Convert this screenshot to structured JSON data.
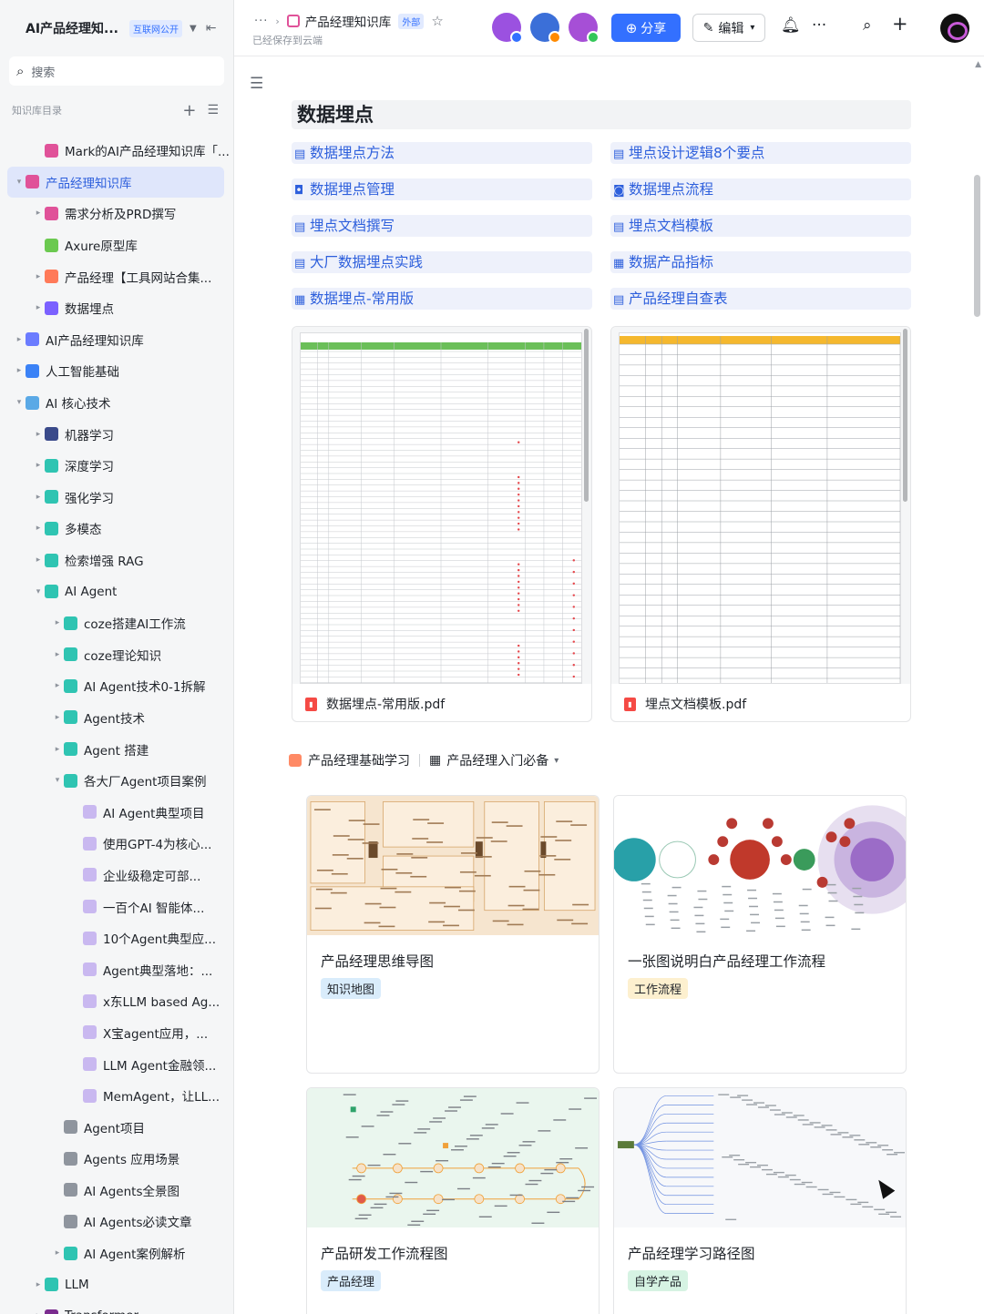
{
  "sidebar": {
    "title": "AI产品经理知...",
    "title_tag": "互联网公开",
    "search_placeholder": "搜索",
    "section_label": "知识库目录",
    "items": [
      {
        "label": "Mark的AI产品经理知识库「...",
        "level": 1,
        "arrow": "",
        "icon": "#e05299",
        "active": false
      },
      {
        "label": "产品经理知识库",
        "level": 0,
        "arrow": "▾",
        "icon": "#e05299",
        "active": true
      },
      {
        "label": "需求分析及PRD撰写",
        "level": 1,
        "arrow": "▸",
        "icon": "#e05299",
        "active": false
      },
      {
        "label": "Axure原型库",
        "level": 1,
        "arrow": "",
        "icon": "#6bc950",
        "active": false
      },
      {
        "label": "产品经理【工具网站合集...",
        "level": 1,
        "arrow": "▸",
        "icon": "#ff7a59",
        "active": false
      },
      {
        "label": "数据埋点",
        "level": 1,
        "arrow": "▸",
        "icon": "#7b61ff",
        "active": false
      },
      {
        "label": "AI产品经理知识库",
        "level": 0,
        "arrow": "▸",
        "icon": "#6b7cff",
        "active": false
      },
      {
        "label": "人工智能基础",
        "level": 0,
        "arrow": "▸",
        "icon": "#3b82f6",
        "active": false
      },
      {
        "label": "AI 核心技术",
        "level": 0,
        "arrow": "▾",
        "icon": "#5aa9e6",
        "active": false
      },
      {
        "label": "机器学习",
        "level": 1,
        "arrow": "▸",
        "icon": "#3a4a8a",
        "active": false
      },
      {
        "label": "深度学习",
        "level": 1,
        "arrow": "▸",
        "icon": "#2fc4b2",
        "active": false
      },
      {
        "label": "强化学习",
        "level": 1,
        "arrow": "▸",
        "icon": "#2fc4b2",
        "active": false
      },
      {
        "label": "多模态",
        "level": 1,
        "arrow": "▸",
        "icon": "#2fc4b2",
        "active": false
      },
      {
        "label": "检索增强 RAG",
        "level": 1,
        "arrow": "▸",
        "icon": "#2fc4b2",
        "active": false
      },
      {
        "label": "AI Agent",
        "level": 1,
        "arrow": "▾",
        "icon": "#2fc4b2",
        "active": false
      },
      {
        "label": "coze搭建AI工作流",
        "level": 2,
        "arrow": "▸",
        "icon": "#2fc4b2",
        "active": false
      },
      {
        "label": "coze理论知识",
        "level": 2,
        "arrow": "▸",
        "icon": "#2fc4b2",
        "active": false
      },
      {
        "label": "AI Agent技术0-1拆解",
        "level": 2,
        "arrow": "▸",
        "icon": "#2fc4b2",
        "active": false
      },
      {
        "label": "Agent技术",
        "level": 2,
        "arrow": "▸",
        "icon": "#2fc4b2",
        "active": false
      },
      {
        "label": "Agent 搭建",
        "level": 2,
        "arrow": "▸",
        "icon": "#2fc4b2",
        "active": false
      },
      {
        "label": "各大厂Agent项目案例",
        "level": 2,
        "arrow": "▾",
        "icon": "#2fc4b2",
        "active": false
      },
      {
        "label": "AI Agent典型项目",
        "level": 3,
        "arrow": "",
        "icon": "#c9b8f0",
        "active": false
      },
      {
        "label": "使用GPT-4为核心...",
        "level": 3,
        "arrow": "",
        "icon": "#c9b8f0",
        "active": false
      },
      {
        "label": "企业级稳定可部...",
        "level": 3,
        "arrow": "",
        "icon": "#c9b8f0",
        "active": false
      },
      {
        "label": "一百个AI 智能体...",
        "level": 3,
        "arrow": "",
        "icon": "#c9b8f0",
        "active": false
      },
      {
        "label": "10个Agent典型应...",
        "level": 3,
        "arrow": "",
        "icon": "#c9b8f0",
        "active": false
      },
      {
        "label": "Agent典型落地：...",
        "level": 3,
        "arrow": "",
        "icon": "#c9b8f0",
        "active": false
      },
      {
        "label": "x东LLM based Ag...",
        "level": 3,
        "arrow": "",
        "icon": "#c9b8f0",
        "active": false
      },
      {
        "label": "X宝agent应用，...",
        "level": 3,
        "arrow": "",
        "icon": "#c9b8f0",
        "active": false
      },
      {
        "label": "LLM Agent金融领...",
        "level": 3,
        "arrow": "",
        "icon": "#c9b8f0",
        "active": false
      },
      {
        "label": "MemAgent，让LL...",
        "level": 3,
        "arrow": "",
        "icon": "#c9b8f0",
        "active": false
      },
      {
        "label": "Agent项目",
        "level": 2,
        "arrow": "",
        "icon": "#8f959e",
        "active": false
      },
      {
        "label": "Agents 应用场景",
        "level": 2,
        "arrow": "",
        "icon": "#8f959e",
        "active": false
      },
      {
        "label": "AI Agents全景图",
        "level": 2,
        "arrow": "",
        "icon": "#8f959e",
        "active": false
      },
      {
        "label": "AI Agents必读文章",
        "level": 2,
        "arrow": "",
        "icon": "#8f959e",
        "active": false
      },
      {
        "label": "AI Agent案例解析",
        "level": 2,
        "arrow": "▸",
        "icon": "#2fc4b2",
        "active": false
      },
      {
        "label": "LLM",
        "level": 1,
        "arrow": "▸",
        "icon": "#2fc4b2",
        "active": false
      },
      {
        "label": "Transformer",
        "level": 1,
        "arrow": "▸",
        "icon": "#7b2c8f",
        "active": false
      }
    ]
  },
  "topbar": {
    "breadcrumb_more": "···",
    "doc_title": "产品经理知识库",
    "doc_tag": "外部",
    "saved_status": "已经保存到云端",
    "share_label": "分享",
    "edit_label": "编辑",
    "avatar_colors": [
      "#9b51e0",
      "#3b6fd8",
      "#a64fd6"
    ],
    "avatar_dot_colors": [
      "#3370ff",
      "#ff8a00",
      "#34c759"
    ]
  },
  "doc": {
    "heading": "数据埋点",
    "links": [
      {
        "icon": "doc-icon",
        "glyph": "▤",
        "label": "数据埋点方法"
      },
      {
        "icon": "doc-icon",
        "glyph": "▤",
        "label": "埋点设计逻辑8个要点"
      },
      {
        "icon": "board-icon",
        "glyph": "◘",
        "label": "数据埋点管理"
      },
      {
        "icon": "flow-icon",
        "glyph": "◙",
        "label": "数据埋点流程"
      },
      {
        "icon": "doc-icon",
        "glyph": "▤",
        "label": "埋点文档撰写"
      },
      {
        "icon": "doc-icon",
        "glyph": "▤",
        "label": "埋点文档模板"
      },
      {
        "icon": "doc-icon",
        "glyph": "▤",
        "label": "大厂数据埋点实践"
      },
      {
        "icon": "sheet-icon",
        "glyph": "▦",
        "label": "数据产品指标"
      },
      {
        "icon": "sheet-icon",
        "glyph": "▦",
        "label": "数据埋点-常用版"
      },
      {
        "icon": "doc-icon",
        "glyph": "▤",
        "label": "产品经理自查表"
      }
    ],
    "files": [
      {
        "name": "数据埋点-常用版.pdf"
      },
      {
        "name": "埋点文档模板.pdf"
      }
    ],
    "category": {
      "label": "产品经理基础学习",
      "view_label": "产品经理入门必备"
    },
    "cards": [
      {
        "title": "产品经理思维导图",
        "tag": "知识地图",
        "tag_bg": "#d9ecfb",
        "tag_color": "#1f2329"
      },
      {
        "title": "一张图说明白产品经理工作流程",
        "tag": "工作流程",
        "tag_bg": "#fdf0cf",
        "tag_color": "#1f2329"
      },
      {
        "title": "产品研发工作流程图",
        "tag": "产品经理",
        "tag_bg": "#d9ecfb",
        "tag_color": "#1f2329"
      },
      {
        "title": "产品经理学习路径图",
        "tag": "自学产品",
        "tag_bg": "#d6f3e3",
        "tag_color": "#1f2329"
      }
    ]
  }
}
